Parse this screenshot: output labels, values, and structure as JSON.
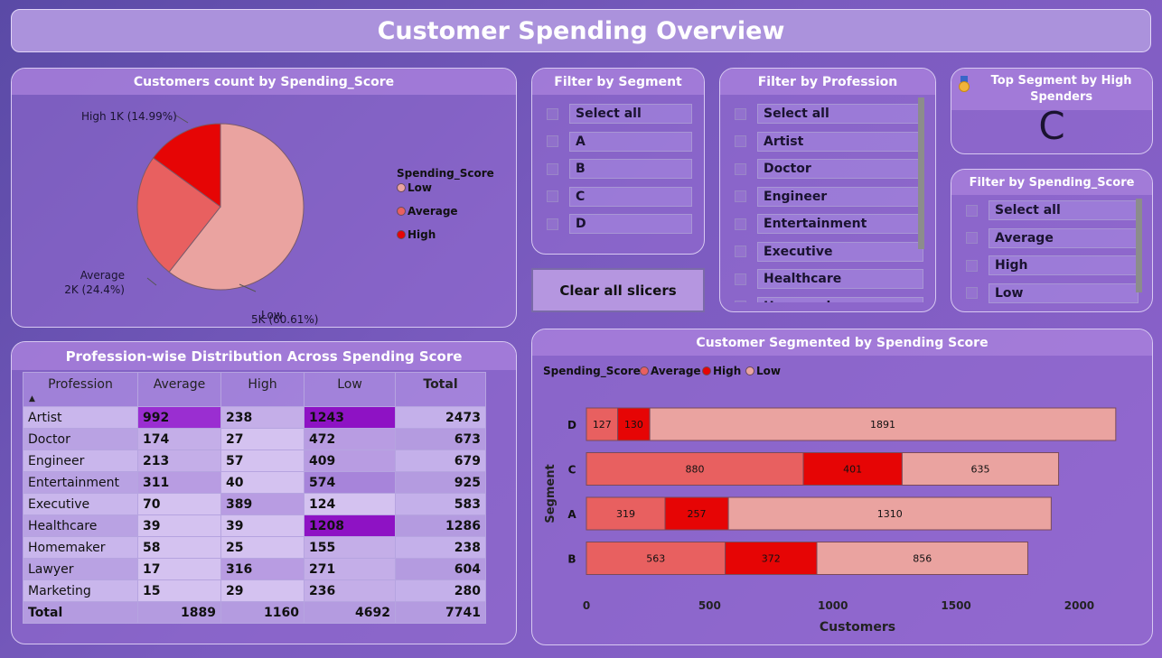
{
  "title": "Customer Spending Overview",
  "pie": {
    "header": "Customers count by Spending_Score",
    "legend_title": "Spending_Score",
    "legend": [
      {
        "label": "Low",
        "color": "#eaa3a0"
      },
      {
        "label": "Average",
        "color": "#e86060"
      },
      {
        "label": "High",
        "color": "#e60505"
      }
    ],
    "labels": {
      "high": "High 1K (14.99%)",
      "average_1": "Average",
      "average_2": "2K (24.4%)",
      "low_1": "Low",
      "low_2": "5K (60.61%)"
    }
  },
  "segment_filter": {
    "header": "Filter by Segment",
    "items": [
      "Select all",
      "A",
      "B",
      "C",
      "D"
    ]
  },
  "profession_filter": {
    "header": "Filter by Profession",
    "items": [
      "Select all",
      "Artist",
      "Doctor",
      "Engineer",
      "Entertainment",
      "Executive",
      "Healthcare",
      "Homemaker"
    ]
  },
  "top_segment": {
    "icon": "medal-icon",
    "header": "Top Segment by High Spenders",
    "value": "C"
  },
  "spending_filter": {
    "header": "Filter by Spending_Score",
    "items": [
      "Select all",
      "Average",
      "High",
      "Low"
    ]
  },
  "clear_button": "Clear all slicers",
  "table": {
    "header": "Profession-wise Distribution Across Spending Score",
    "columns": [
      "Profession",
      "Average",
      "High",
      "Low",
      "Total"
    ],
    "rows": [
      [
        "Artist",
        "992",
        "238",
        "1243",
        "2473"
      ],
      [
        "Doctor",
        "174",
        "27",
        "472",
        "673"
      ],
      [
        "Engineer",
        "213",
        "57",
        "409",
        "679"
      ],
      [
        "Entertainment",
        "311",
        "40",
        "574",
        "925"
      ],
      [
        "Executive",
        "70",
        "389",
        "124",
        "583"
      ],
      [
        "Healthcare",
        "39",
        "39",
        "1208",
        "1286"
      ],
      [
        "Homemaker",
        "58",
        "25",
        "155",
        "238"
      ],
      [
        "Lawyer",
        "17",
        "316",
        "271",
        "604"
      ],
      [
        "Marketing",
        "15",
        "29",
        "236",
        "280"
      ]
    ],
    "total_row": [
      "Total",
      "1889",
      "1160",
      "4692",
      "7741"
    ]
  },
  "bar": {
    "header": "Customer Segmented by Spending Score",
    "legend_title": "Spending_Score",
    "legend": [
      {
        "label": "Average",
        "color": "#e86060"
      },
      {
        "label": "High",
        "color": "#e60505"
      },
      {
        "label": "Low",
        "color": "#eaa3a0"
      }
    ]
  },
  "chart_data": [
    {
      "type": "pie",
      "title": "Customers count by Spending_Score",
      "legend_title": "Spending_Score",
      "categories": [
        "Low",
        "Average",
        "High"
      ],
      "values": [
        60.61,
        24.4,
        14.99
      ],
      "value_labels": [
        "5K (60.61%)",
        "2K (24.4%)",
        "1K (14.99%)"
      ],
      "colors": [
        "#eaa3a0",
        "#e86060",
        "#e60505"
      ],
      "legend_placement": "right"
    },
    {
      "type": "bar",
      "orientation": "horizontal",
      "stacked": true,
      "title": "Customer Segmented by Spending Score",
      "xlabel": "Customers",
      "ylabel": "Segment",
      "categories": [
        "D",
        "C",
        "A",
        "B"
      ],
      "series": [
        {
          "name": "Average",
          "values": [
            127,
            880,
            319,
            563
          ],
          "color": "#e86060"
        },
        {
          "name": "High",
          "values": [
            130,
            401,
            257,
            372
          ],
          "color": "#e60505"
        },
        {
          "name": "Low",
          "values": [
            1891,
            635,
            1310,
            856
          ],
          "color": "#eaa3a0"
        }
      ],
      "xlim": [
        0,
        2200
      ],
      "xticks": [
        0,
        500,
        1000,
        1500,
        2000
      ],
      "legend_placement": "top-left",
      "grid": false
    }
  ]
}
